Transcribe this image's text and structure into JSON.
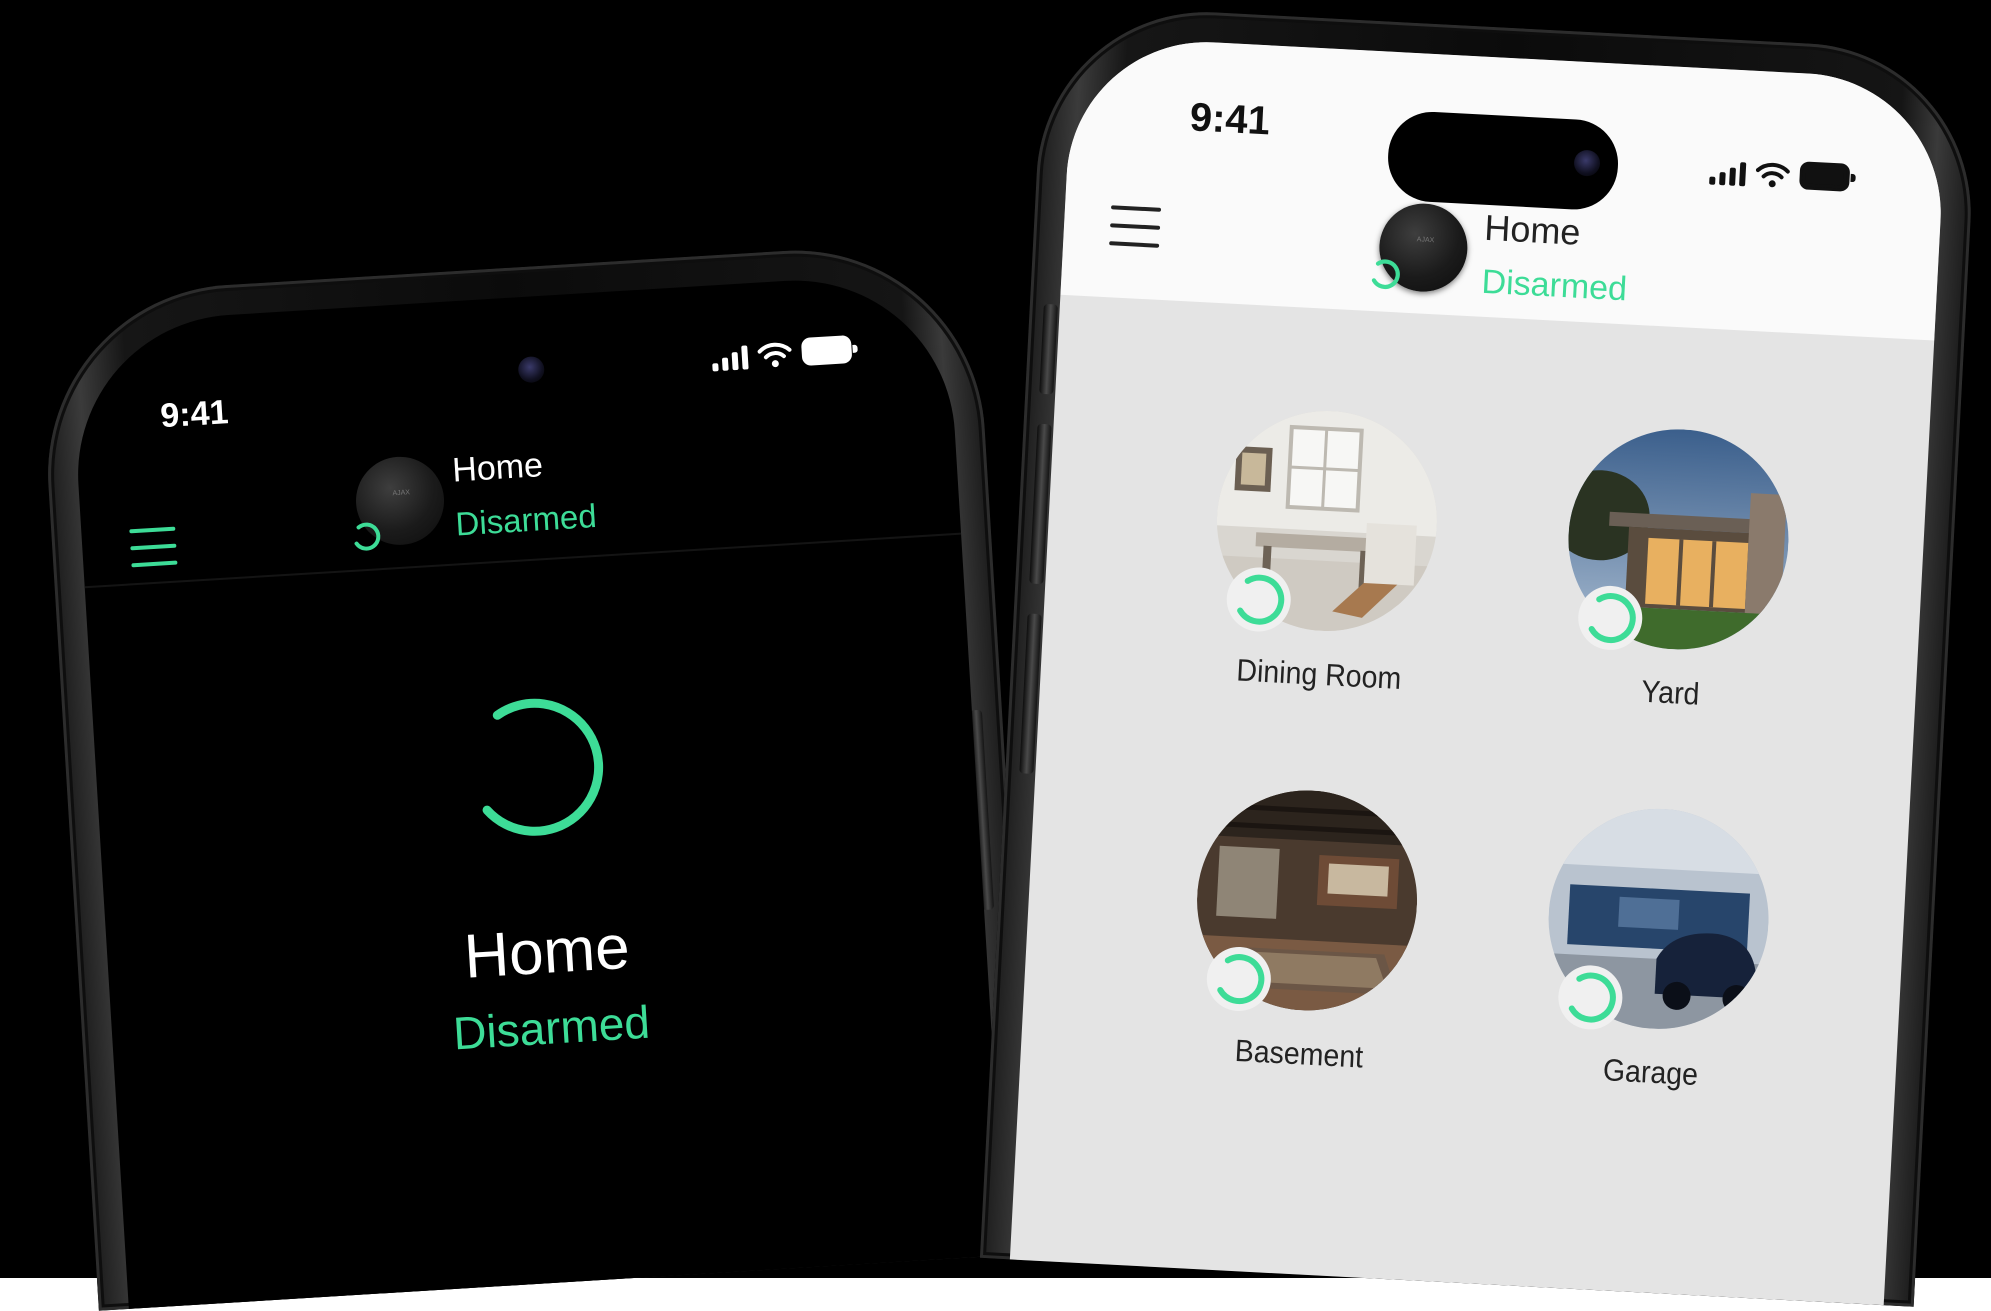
{
  "colors": {
    "accent": "#3ddc97",
    "dark_screen": "#000000",
    "light_screen": "#e4e4e4",
    "header_light": "#fafafa"
  },
  "left_phone": {
    "status_bar": {
      "time": "9:41",
      "icons": [
        "signal-icon",
        "wifi-icon",
        "battery-icon"
      ]
    },
    "header": {
      "hub_name": "Home",
      "hub_status": "Disarmed",
      "menu_icon": "menu-icon"
    },
    "main": {
      "ring_icon": "security-status-ring-icon",
      "title": "Home",
      "status": "Disarmed"
    }
  },
  "right_phone": {
    "status_bar": {
      "time": "9:41",
      "icons": [
        "signal-icon",
        "wifi-icon",
        "battery-icon"
      ]
    },
    "header": {
      "hub_name": "Home",
      "hub_status": "Disarmed",
      "menu_icon": "menu-icon"
    },
    "rooms": [
      {
        "name": "Dining Room"
      },
      {
        "name": "Yard"
      },
      {
        "name": "Basement"
      },
      {
        "name": "Garage"
      }
    ]
  }
}
